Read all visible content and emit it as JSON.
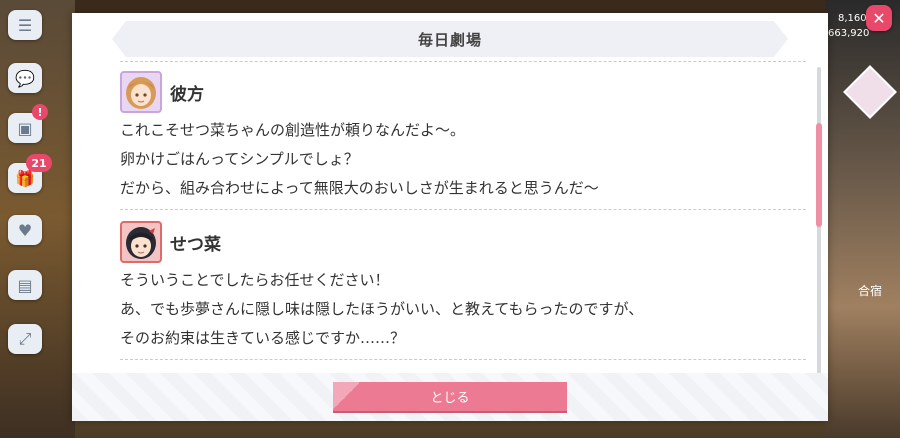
{
  "hud": {
    "count_1": "8,160",
    "count_2": "663,920",
    "badge_number": "21",
    "badge_alert": "!",
    "right_label": "合宿"
  },
  "modal": {
    "title": "毎日劇場",
    "close_label": "とじる"
  },
  "dialogue": [
    {
      "speaker": "彼方",
      "lines": [
        "これこそせつ菜ちゃんの創造性が頼りなんだよ〜。",
        "卵かけごはんってシンプルでしょ？",
        "だから、組み合わせによって無限大のおいしさが生まれると思うんだ〜"
      ]
    },
    {
      "speaker": "せつ菜",
      "lines": [
        "そういうことでしたらお任せください！",
        "あ、でも歩夢さんに隠し味は隠したほうがいい、と教えてもらったのですが、",
        "そのお約束は生きている感じですか……？"
      ]
    }
  ],
  "colors": {
    "accent": "#ec7a93",
    "header_bg": "#eef0f6"
  }
}
